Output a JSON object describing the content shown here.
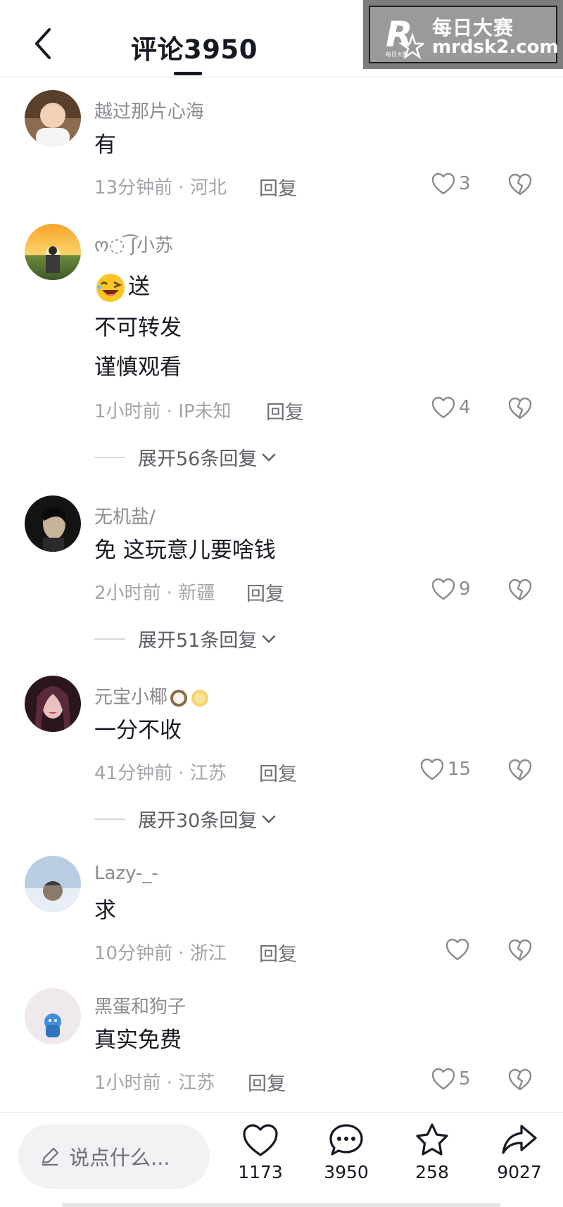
{
  "header": {
    "title": "评论3950"
  },
  "watermark": {
    "brand_cn": "每日大赛",
    "url": "mrdsk2.com"
  },
  "comments": [
    {
      "user": "越过那片心海",
      "text": [
        "有"
      ],
      "time": "13分钟前 · 河北",
      "reply": "回复",
      "likes": "3"
    },
    {
      "user": "ო◌ ͡ʃ小苏",
      "text": [
        "送",
        "不可转发",
        "谨慎观看"
      ],
      "time": "1小时前 · IP未知",
      "reply": "回复",
      "likes": "4",
      "expand": "展开56条回复"
    },
    {
      "user": "无机盐/",
      "text": [
        "免 这玩意儿要啥钱"
      ],
      "time": "2小时前 · 新疆",
      "reply": "回复",
      "likes": "9",
      "expand": "展开51条回复"
    },
    {
      "user": "元宝小椰",
      "text": [
        "一分不收"
      ],
      "time": "41分钟前 · 江苏",
      "reply": "回复",
      "likes": "15",
      "expand": "展开30条回复"
    },
    {
      "user": "Lazy-_-",
      "text": [
        "求"
      ],
      "time": "10分钟前 · 浙江",
      "reply": "回复",
      "likes": ""
    },
    {
      "user": "黑蛋和狗子",
      "text": [
        "真实免费"
      ],
      "time": "1小时前 · 江苏",
      "reply": "回复",
      "likes": "5"
    }
  ],
  "bottom": {
    "placeholder": "说点什么...",
    "likes": "1173",
    "comments": "3950",
    "favorites": "258",
    "shares": "9027"
  },
  "icons": [
    "back-icon",
    "heart-icon",
    "broken-heart-icon",
    "chevron-down-icon",
    "pencil-icon",
    "comment-icon",
    "star-icon",
    "share-icon"
  ],
  "colors": {
    "text": "#161823",
    "meta": "#a3a4a9",
    "accent_line": "#161823"
  }
}
